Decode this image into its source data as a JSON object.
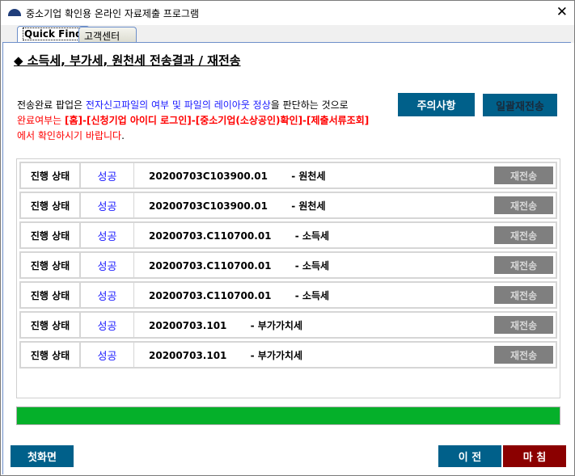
{
  "window": {
    "title": "중소기업 확인용 온라인 자료제출 프로그램",
    "close": "✕"
  },
  "tabs": [
    {
      "label": "Quick Find"
    },
    {
      "label": "고객센터"
    }
  ],
  "heading": "◆ 소득세, 부가세, 원천세 전송결과 / 재전송",
  "notice": {
    "l1a": "전송완료 팝업은 ",
    "l1b": "전자신고파일의 여부 및 파일의 레이아웃 정상",
    "l1c": "을 판단하는 것으로",
    "l2a": "완료여부는 ",
    "l2b": "[홈]-[신청기업 아이디 로그인]-[중소기업(소상공인)확인]-[제출서류조회]",
    "l3a": "에서 확인하시기 바랍니다",
    "l3b": "."
  },
  "buttons": {
    "caution": "주의사항",
    "bulk_resend": "일괄재전송",
    "home": "첫화면",
    "prev": "이 전",
    "finish": "마 침"
  },
  "rows": [
    {
      "label": "진행 상태",
      "status": "성공",
      "id": "20200703C103900.01",
      "tax": "       - 원천세",
      "action": "재전송"
    },
    {
      "label": "진행 상태",
      "status": "성공",
      "id": "20200703C103900.01",
      "tax": "       - 원천세",
      "action": "재전송"
    },
    {
      "label": "진행 상태",
      "status": "성공",
      "id": "20200703.C110700.01",
      "tax": "       - 소득세",
      "action": "재전송"
    },
    {
      "label": "진행 상태",
      "status": "성공",
      "id": "20200703.C110700.01",
      "tax": "       - 소득세",
      "action": "재전송"
    },
    {
      "label": "진행 상태",
      "status": "성공",
      "id": "20200703.C110700.01",
      "tax": "       - 소득세",
      "action": "재전송"
    },
    {
      "label": "진행 상태",
      "status": "성공",
      "id": "20200703.101",
      "tax": "       - 부가가치세",
      "action": "재전송"
    },
    {
      "label": "진행 상태",
      "status": "성공",
      "id": "20200703.101",
      "tax": "       - 부가가치세",
      "action": "재전송"
    }
  ],
  "progress": {
    "percent": 100
  },
  "colors": {
    "button_blue": "#00608a",
    "finish_red": "#8b0000",
    "progress_green": "#05b02a"
  }
}
